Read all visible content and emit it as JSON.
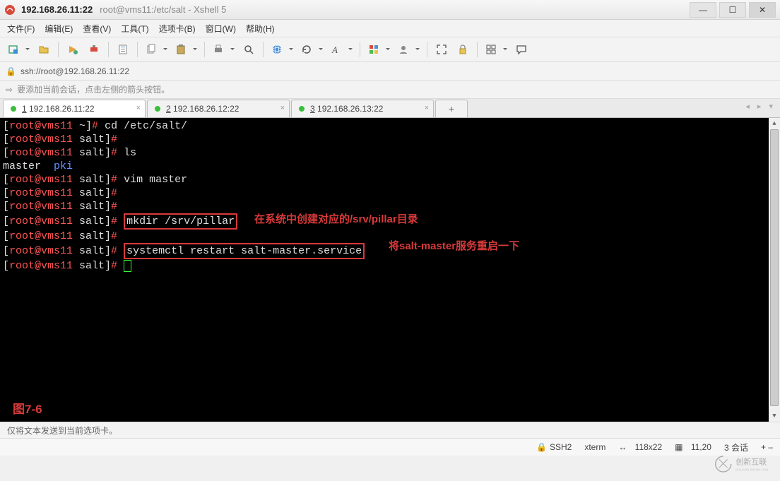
{
  "window": {
    "title_bold": "192.168.26.11:22",
    "title_rest": "root@vms11:/etc/salt - Xshell 5"
  },
  "menu": {
    "file": "文件(F)",
    "edit": "编辑(E)",
    "view": "查看(V)",
    "tools": "工具(T)",
    "tabs": "选项卡(B)",
    "window": "窗口(W)",
    "help": "帮助(H)"
  },
  "toolbar_icons": [
    "new-tab-icon",
    "open-icon",
    "sep",
    "reconnect-icon",
    "disconnect-icon",
    "sep",
    "properties-icon",
    "sep",
    "copy-icon",
    "paste-icon",
    "sep",
    "print-icon",
    "find-icon",
    "sep",
    "globe-icon",
    "history-icon",
    "font-icon",
    "sep",
    "color-icon",
    "profile-icon",
    "sep",
    "fullscreen-icon",
    "lock-session-icon",
    "sep",
    "tile-icon",
    "chat-icon"
  ],
  "address": {
    "url": "ssh://root@192.168.26.11:22"
  },
  "hint": {
    "text": "要添加当前会话，点击左侧的箭头按钮。"
  },
  "tabs": [
    {
      "num": "1",
      "label": "192.168.26.11:22",
      "active": true
    },
    {
      "num": "2",
      "label": "192.168.26.12:22",
      "active": false
    },
    {
      "num": "3",
      "label": "192.168.26.13:22",
      "active": false
    }
  ],
  "terminal": {
    "lines": [
      {
        "prompt": "[root@vms11 ~]#",
        "cmd": " cd /etc/salt/"
      },
      {
        "prompt": "[root@vms11 salt]#",
        "cmd": ""
      },
      {
        "prompt": "[root@vms11 salt]#",
        "cmd": " ls"
      },
      {
        "plain_left": "master  ",
        "plain_blue": "pki"
      },
      {
        "prompt": "[root@vms11 salt]#",
        "cmd": " vim master"
      },
      {
        "prompt": "[root@vms11 salt]#",
        "cmd": ""
      },
      {
        "prompt": "[root@vms11 salt]#",
        "cmd": ""
      },
      {
        "prompt": "[root@vms11 salt]#",
        "cmd_boxed": "mkdir /srv/pillar"
      },
      {
        "prompt": "[root@vms11 salt]#",
        "cmd": ""
      },
      {
        "prompt": "[root@vms11 salt]#",
        "cmd_boxed": "systemctl restart salt-master.service"
      },
      {
        "prompt": "[root@vms11 salt]#",
        "cursor": true
      }
    ],
    "note1": "在系统中创建对应的/srv/pillar目录",
    "note2": "将salt-master服务重启一下",
    "figure": "图7-6"
  },
  "status_hint": "仅将文本发送到当前选项卡。",
  "status": {
    "proto": "SSH2",
    "term": "xterm",
    "size": "118x22",
    "pos": "11,20",
    "sessions": "3 会话",
    "plus_minus": "+  –"
  },
  "watermark": "创新互联"
}
